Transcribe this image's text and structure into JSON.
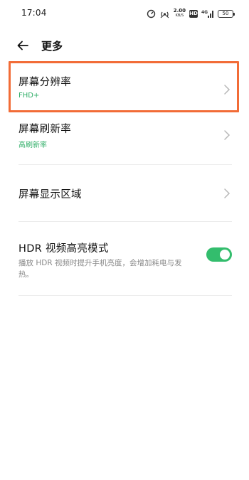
{
  "status_bar": {
    "time": "17:04",
    "speed_value": "2.00",
    "speed_unit": "KB/S",
    "hd_label": "HD",
    "signal_label": "4G",
    "battery": "50"
  },
  "header": {
    "title": "更多",
    "back_icon": "back-arrow-icon"
  },
  "items": [
    {
      "title": "屏幕分辨率",
      "subtitle": "FHD+",
      "has_chevron": true
    },
    {
      "title": "屏幕刷新率",
      "subtitle": "高刷新率",
      "has_chevron": true
    },
    {
      "title": "屏幕显示区域",
      "has_chevron": true
    },
    {
      "title": "HDR 视频高亮模式",
      "description": "播放 HDR 视频时提升手机亮度，会增加耗电与发热。",
      "toggle_on": true
    }
  ],
  "colors": {
    "highlight": "#f26c37",
    "accent_green": "#2fae67",
    "toggle_on": "#33bd6d"
  }
}
